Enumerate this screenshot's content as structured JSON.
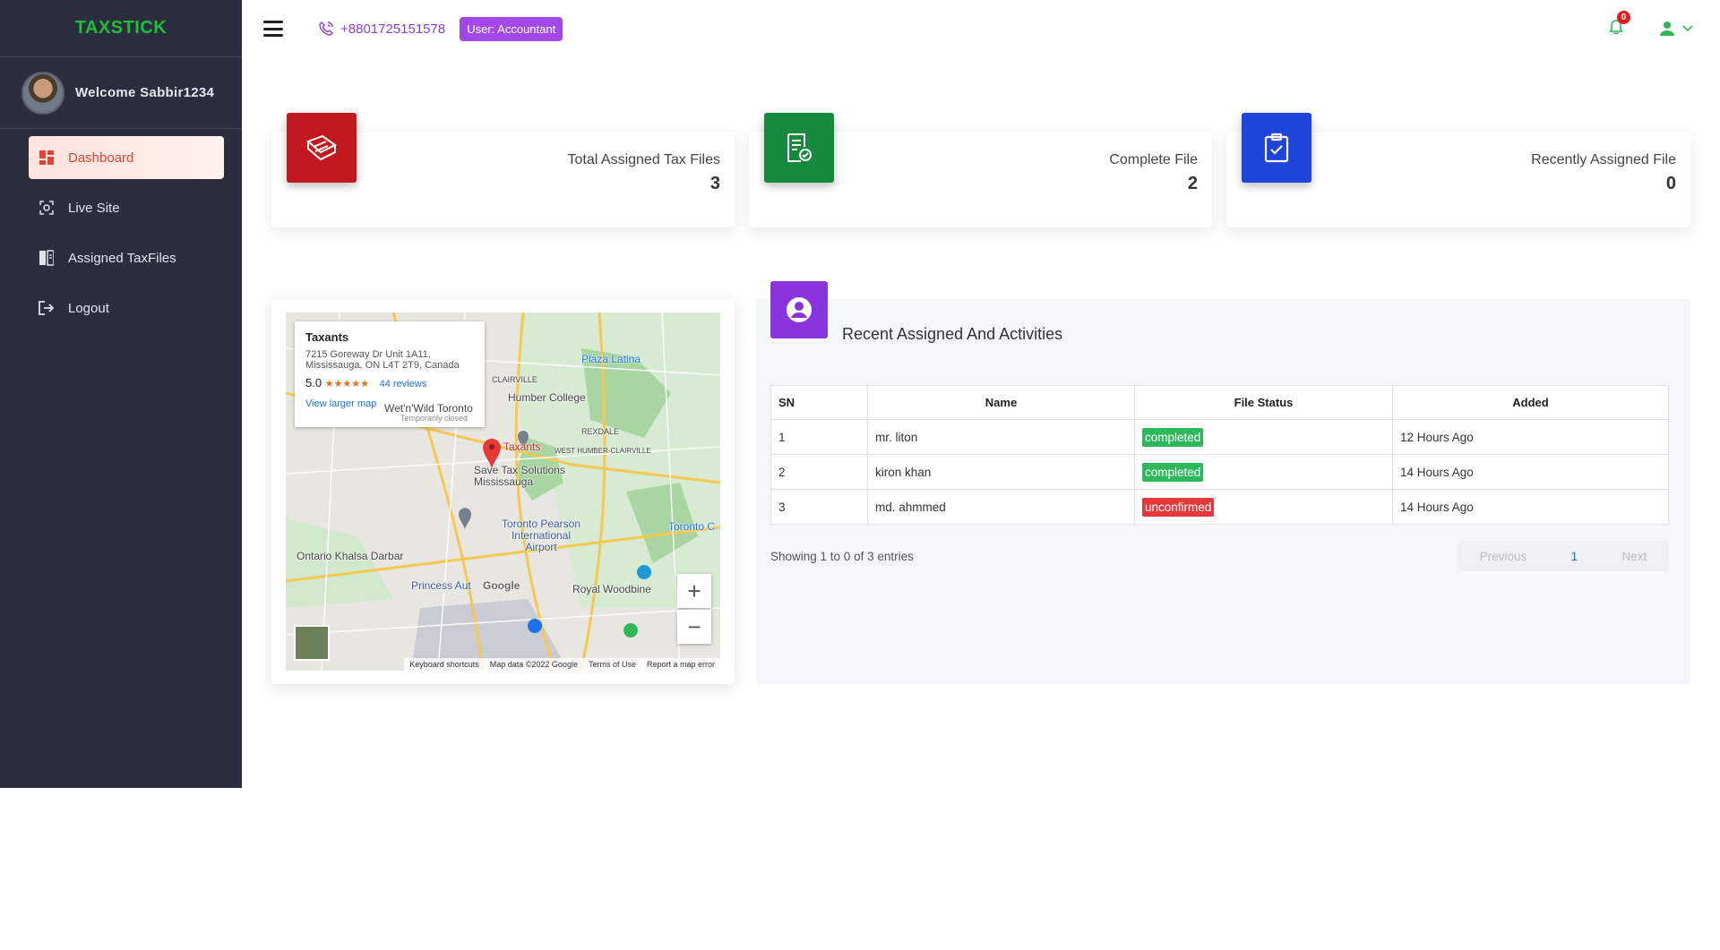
{
  "brand": {
    "logo_text": "TAXSTICK"
  },
  "sidebar": {
    "welcome": "Welcome Sabbir1234",
    "items": [
      {
        "label": "Dashboard",
        "icon": "dashboard-icon",
        "active": true
      },
      {
        "label": "Live Site",
        "icon": "live-site-icon"
      },
      {
        "label": "Assigned TaxFiles",
        "icon": "assigned-files-icon"
      },
      {
        "label": "Logout",
        "icon": "logout-icon"
      }
    ]
  },
  "topbar": {
    "phone": "+8801725151578",
    "user_badge": "User:  Accountant",
    "notification_count": "0"
  },
  "cards": [
    {
      "label": "Total Assigned Tax Files",
      "value": "3",
      "color": "#c2191f"
    },
    {
      "label": "Complete File",
      "value": "2",
      "color": "#168a3c"
    },
    {
      "label": "Recently Assigned File",
      "value": "0",
      "color": "#1e44d8"
    }
  ],
  "map": {
    "place_name": "Taxants",
    "address": "7215 Goreway Dr Unit 1A11, Mississauga, ON L4T 2T9, Canada",
    "rating": "5.0",
    "stars": "★★★★★",
    "reviews": "44 reviews",
    "larger_map": "View larger map",
    "labels": {
      "plaza": "Plaza Latina",
      "humber": "Humber College",
      "clairville": "CLAIRVILLE",
      "rexdale": "REXDALE",
      "west_humber": "WEST HUMBER-CLAIRVILLE",
      "wild_toronto": "Wet'n'Wild Toronto",
      "closed": "Temporarily closed",
      "pin": "Taxants",
      "save_tax": "Save Tax Solutions Mississauga",
      "airport": "Toronto Pearson International Airport",
      "khalsa": "Ontario Khalsa Darbar",
      "princess": "Princess Aut",
      "woodbine": "Royal Woodbine",
      "toronto_c": "Toronto C",
      "google": "Google"
    },
    "footer": [
      "Keyboard shortcuts",
      "Map data ©2022 Google",
      "Terms of Use",
      "Report a map error"
    ]
  },
  "recent": {
    "title": "Recent Assigned And Activities",
    "columns": [
      "SN",
      "Name",
      "File Status",
      "Added"
    ],
    "rows": [
      {
        "sn": "1",
        "name": "mr. liton",
        "status": "completed",
        "added": "12 Hours Ago"
      },
      {
        "sn": "2",
        "name": "kiron khan",
        "status": "completed",
        "added": "14 Hours Ago"
      },
      {
        "sn": "3",
        "name": "md. ahmmed",
        "status": "unconfirmed",
        "added": "14 Hours Ago"
      }
    ],
    "showing": "Showing 1 to 0 of 3 entries",
    "pager": {
      "previous": "Previous",
      "page": "1",
      "next": "Next"
    }
  }
}
